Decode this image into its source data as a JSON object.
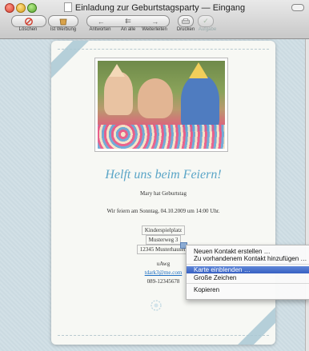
{
  "window": {
    "title": "Einladung zur Geburtstagsparty — Eingang"
  },
  "toolbar": {
    "delete": "Löschen",
    "junk": "Ist Werbung",
    "reply": "Antworten",
    "reply_all": "An alle",
    "forward": "Weiterleiten",
    "print": "Drucken",
    "todo": "Aufgabe"
  },
  "card": {
    "headline": "Helft uns beim Feiern!",
    "subline": "Mary hat Geburtstag",
    "date_line": "Wir feiern am Sonntag, 04.10.2009 um 14:00 Uhr.",
    "address": {
      "place": "Kinderspielplatz",
      "street": "Musterweg 3",
      "city": "12345 Musterhausen"
    },
    "rsvp": {
      "label": "uAwg",
      "email": "tdark3@me.com",
      "phone": "089-12345678"
    }
  },
  "context_menu": {
    "items": [
      {
        "label": "Neuen Kontakt erstellen …"
      },
      {
        "label": "Zu vorhandenem Kontakt hinzufügen …"
      },
      {
        "label": "Karte einblenden …"
      },
      {
        "label": "Große Zeichen"
      },
      {
        "label": "Kopieren"
      }
    ],
    "selected_index": 2
  },
  "colors": {
    "headline": "#5aa5c7",
    "menu_selection": "#3d67c8",
    "link": "#1d6fc3"
  }
}
